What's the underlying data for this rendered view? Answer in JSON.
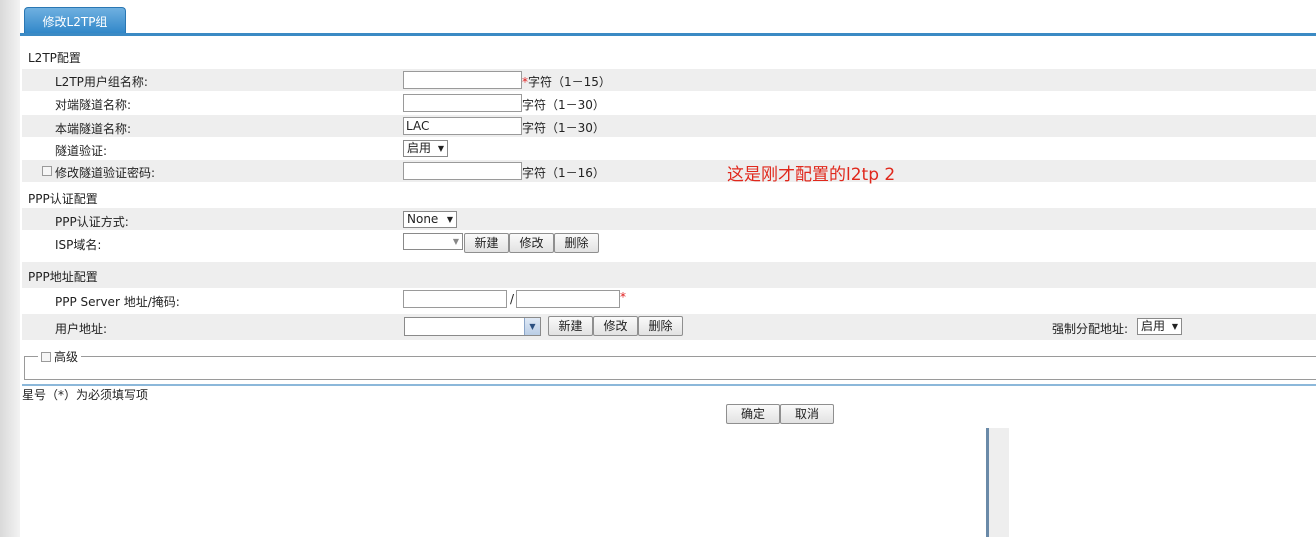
{
  "tab": {
    "title": "修改L2TP组"
  },
  "sections": {
    "l2tp": "L2TP配置",
    "ppp_auth": "PPP认证配置",
    "ppp_addr": "PPP地址配置"
  },
  "fields": {
    "group_name_label": "L2TP用户组名称:",
    "group_name_value": "",
    "group_name_hint": "字符（1－15）",
    "peer_tunnel_label": "对端隧道名称:",
    "peer_tunnel_value": "",
    "peer_tunnel_hint": "字符（1－30）",
    "local_tunnel_label": "本端隧道名称:",
    "local_tunnel_value": "LAC",
    "local_tunnel_hint": "字符（1－30）",
    "tunnel_auth_label": "隧道验证:",
    "tunnel_auth_value": "启用",
    "tunnel_pwd_label": "修改隧道验证密码:",
    "tunnel_pwd_value": "",
    "tunnel_pwd_hint": "字符（1－16）",
    "ppp_auth_mode_label": "PPP认证方式:",
    "ppp_auth_mode_value": "None",
    "isp_domain_label": "ISP域名:",
    "isp_domain_value": "",
    "ppp_server_label": "PPP Server 地址/掩码:",
    "ppp_server_addr": "",
    "ppp_server_mask": "",
    "slash": "/",
    "user_addr_label": "用户地址:",
    "user_addr_value": "",
    "force_assign_label": "强制分配地址:",
    "force_assign_value": "启用"
  },
  "buttons": {
    "new": "新建",
    "modify": "修改",
    "delete": "删除",
    "ok": "确定",
    "cancel": "取消"
  },
  "required_mark": "*",
  "advanced_label": "高级",
  "footnote": "星号（*）为必须填写项",
  "annotation": "这是刚才配置的l2tp 2",
  "colors": {
    "tab": "#2f86c8",
    "required": "#e02020",
    "annotation": "#e0281c"
  },
  "icons": {
    "dropdown": "triangle-down",
    "checkbox": "square"
  }
}
